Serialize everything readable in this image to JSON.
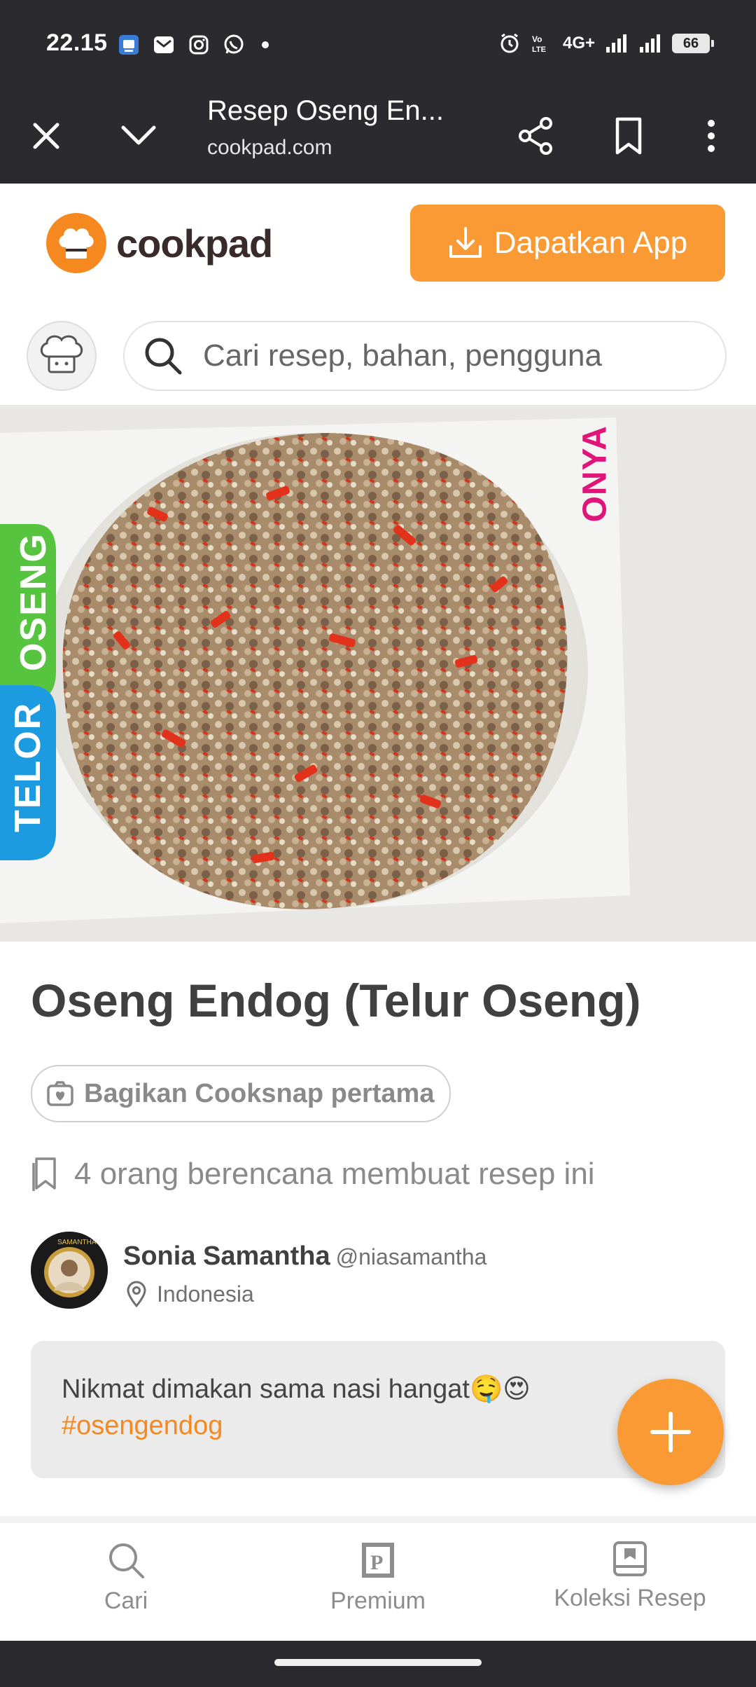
{
  "status_bar": {
    "time": "22.15",
    "left_icons": [
      "app-icon",
      "mail-icon",
      "instagram-icon",
      "whatsapp-icon",
      "dot-icon"
    ],
    "right_icons": [
      "alarm-icon",
      "volte-icon",
      "signal-icon",
      "signal-icon",
      "battery-icon"
    ],
    "network": "4G+",
    "battery": "66"
  },
  "browser": {
    "title": "Resep Oseng En...",
    "url": "cookpad.com"
  },
  "header": {
    "logo_text": "cookpad",
    "get_app_label": "Dapatkan App"
  },
  "search": {
    "placeholder": "Cari resep, bahan, pengguna"
  },
  "recipe": {
    "title": "Oseng Endog (Telur Oseng)",
    "cooksnap_label": "Bagikan Cooksnap pertama",
    "planned_text": "4 orang berencana membuat resep ini",
    "author": {
      "name": "Sonia Samantha",
      "handle": "@niasamantha",
      "location": "Indonesia"
    },
    "description": "Nikmat dimakan sama nasi hangat🤤😍",
    "hashtag": "#osengendog",
    "image_labels": {
      "telor": "TELOR",
      "oseng": "OSENG",
      "onya": "ONYA"
    }
  },
  "bottom_nav": {
    "items": [
      {
        "label": "Cari",
        "icon": "search-icon"
      },
      {
        "label": "Premium",
        "icon": "premium-icon"
      },
      {
        "label": "Koleksi Resep",
        "icon": "collection-icon"
      }
    ]
  },
  "colors": {
    "accent": "#f99a34",
    "status_bar": "#2b2b2f",
    "hashtag": "#f5891f"
  }
}
